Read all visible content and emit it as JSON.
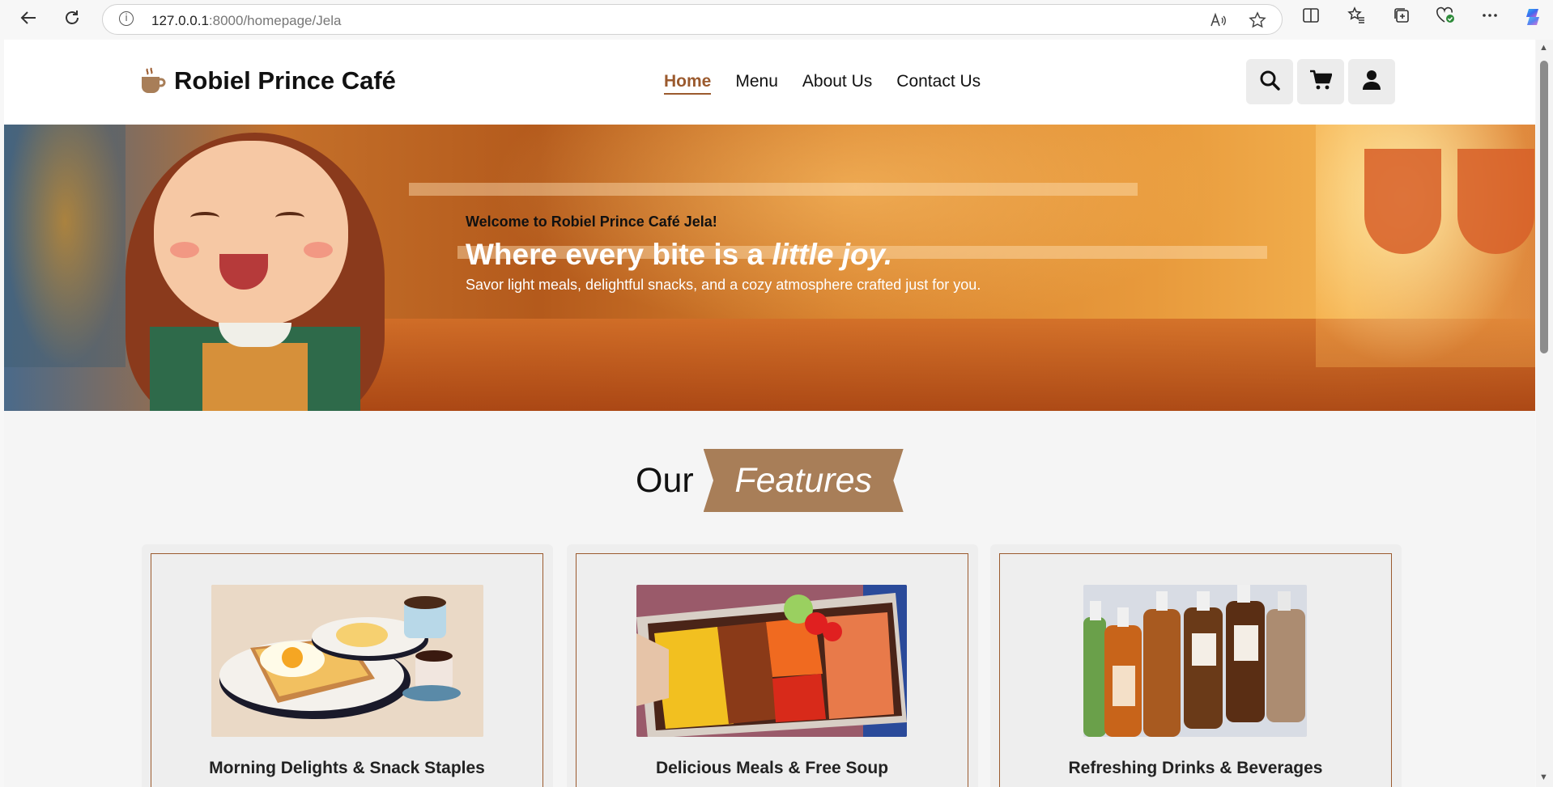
{
  "browser": {
    "url_host": "127.0.0.1",
    "url_path": ":8000/homepage/Jela"
  },
  "site": {
    "brand": "Robiel Prince Café",
    "nav": [
      {
        "label": "Home",
        "active": true
      },
      {
        "label": "Menu",
        "active": false
      },
      {
        "label": "About Us",
        "active": false
      },
      {
        "label": "Contact Us",
        "active": false
      }
    ],
    "header_icons": [
      "search-icon",
      "cart-icon",
      "user-icon"
    ],
    "accent_color": "#9b5a2e"
  },
  "hero": {
    "welcome": "Welcome to Robiel Prince Café Jela!",
    "title_plain": "Where every bite is a ",
    "title_emphasis": "little joy.",
    "subtitle": "Savor light meals, delightful snacks, and a cozy atmosphere crafted just for you."
  },
  "features": {
    "heading_plain": "Our",
    "heading_ribbon": "Features",
    "ribbon_color": "#a87e58",
    "cards": [
      {
        "title": "Morning Delights & Snack Staples"
      },
      {
        "title": "Delicious Meals & Free Soup"
      },
      {
        "title": "Refreshing Drinks & Beverages"
      }
    ]
  }
}
